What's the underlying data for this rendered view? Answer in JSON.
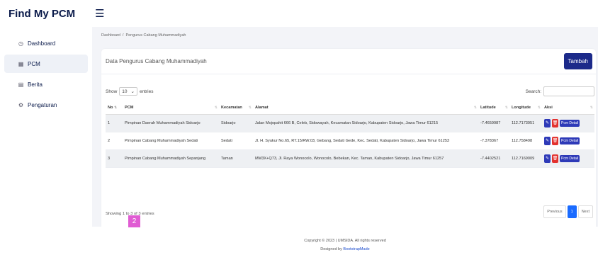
{
  "app": {
    "brand": "Find My PCM",
    "menu_icon": "hamburger-icon"
  },
  "sidebar": {
    "items": [
      {
        "label": "Dashboard",
        "icon": "clock-icon",
        "active": false
      },
      {
        "label": "PCM",
        "icon": "building-icon",
        "active": true
      },
      {
        "label": "Berita",
        "icon": "newspaper-icon",
        "active": false
      },
      {
        "label": "Pengaturan",
        "icon": "gear-icon",
        "active": false
      }
    ]
  },
  "breadcrumb": {
    "home": "Dashboard",
    "current": "Pengurus Cabang Muhammadiyah",
    "separator": "/"
  },
  "card": {
    "title": "Data Pengurus Cabang Muhammadiyah",
    "add_label": "Tambah"
  },
  "controls": {
    "show_label": "Show",
    "page_size": "10",
    "entries_label": "entries",
    "search_label": "Search:",
    "search_value": ""
  },
  "table": {
    "headers": [
      "No",
      "PCM",
      "Kecamatan",
      "Alamat",
      "Latitude",
      "Longitude",
      "Aksi"
    ],
    "rows": [
      {
        "no": "1",
        "pcm": "Pimpinan Daerah Muhammadiyah Sidoarjo",
        "kecamatan": "Sidoarjo",
        "alamat": "Jalan Mojopahit 666 B, Celeb, Sidowayah, Kecamatan Sidoarjo, Kabupaten Sidoarjo, Jawa Timur 61215",
        "lat": "-7.4659987",
        "lng": "112.7173951"
      },
      {
        "no": "2",
        "pcm": "Pimpinan Cabang Muhammadiyah Sedati",
        "kecamatan": "Sedati",
        "alamat": "Jl. H. Syukur No.65, RT.15/RW.03, Gebang, Sedati Gede, Kec. Sedati, Kabupaten Sidoarjo, Jawa Timur 61253",
        "lat": "-7.378367",
        "lng": "112.758498"
      },
      {
        "no": "3",
        "pcm": "Pimpinan Cabang Muhammadiyah Sepanjang",
        "kecamatan": "Taman",
        "alamat": "MM3X+Q73, Jl. Raya Wonocolo, Wonocolo, Bebekan, Kec. Taman, Kabupaten Sidoarjo, Jawa Timur 61257",
        "lat": "-7.4402521",
        "lng": "112.7169009"
      }
    ],
    "detail_label": "Pcm Detail"
  },
  "info": "Showing 1 to 3 of 3 entries",
  "pagination": {
    "previous": "Previous",
    "current": "1",
    "next": "Next"
  },
  "footer": {
    "copyright": "Copyright © 2023 | UMSIDA. All rights reserved",
    "designed_by": "Designed by",
    "credit": "BootstrapMade"
  },
  "badge": "2",
  "colors": {
    "primary": "#1c2a8a",
    "danger": "#e3322f",
    "active_page": "#1a6bff"
  }
}
